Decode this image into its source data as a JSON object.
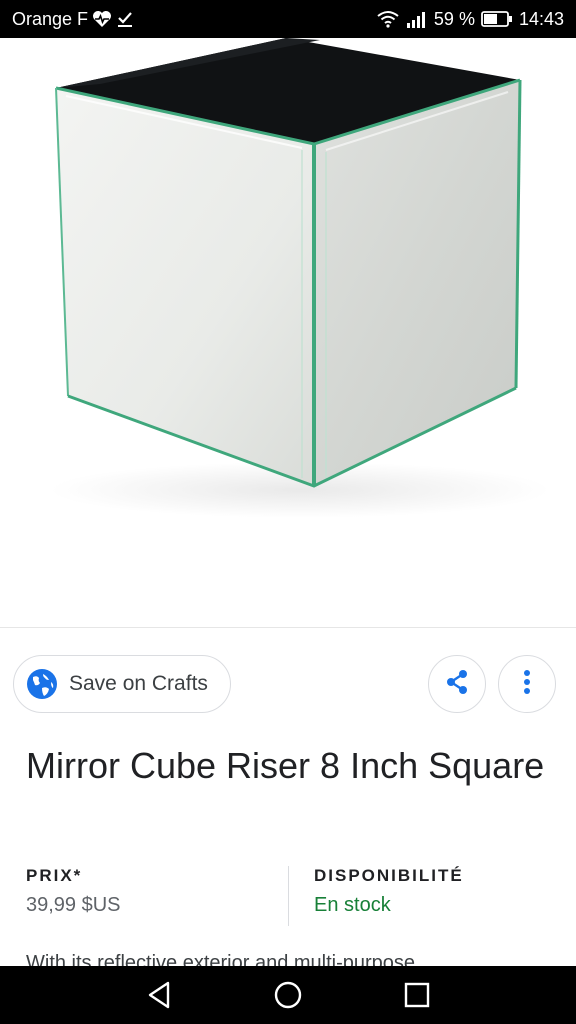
{
  "status_bar": {
    "carrier": "Orange F",
    "battery": "59 %",
    "time": "14:43",
    "icons": [
      "heartbeat-icon",
      "check-download-icon",
      "wifi-icon",
      "signal-icon",
      "battery-icon"
    ]
  },
  "product": {
    "image_icon": "mirror-cube-image",
    "save_label": "Save on Crafts",
    "title": "Mirror Cube Riser 8 Inch Square",
    "price_heading": "PRIX*",
    "price_value": "39,99 $US",
    "availability_heading": "DISPONIBILITÉ",
    "availability_value": "En stock",
    "description": "With its reflective exterior and multi-purpose"
  },
  "actions": {
    "share_icon": "share-icon",
    "more_icon": "more-vertical-icon"
  },
  "nav": {
    "icons": [
      "back-icon",
      "home-icon",
      "recent-apps-icon"
    ]
  },
  "colors": {
    "accent_blue": "#1a73e8",
    "in_stock_green": "#188038",
    "glass_edge_green": "#3fa77c"
  }
}
